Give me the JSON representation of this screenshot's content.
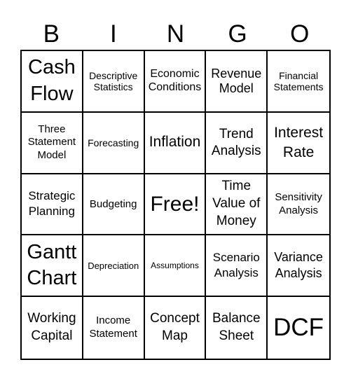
{
  "header": {
    "letters": [
      "B",
      "I",
      "N",
      "G",
      "O"
    ]
  },
  "board": {
    "rows": [
      [
        {
          "lines": [
            "Cash",
            "Flow"
          ]
        },
        {
          "lines": [
            "Descriptive",
            "Statistics"
          ]
        },
        {
          "lines": [
            "Economic",
            "Conditions"
          ]
        },
        {
          "lines": [
            "Revenue",
            "Model"
          ]
        },
        {
          "lines": [
            "Financial",
            "Statements"
          ]
        }
      ],
      [
        {
          "lines": [
            "Three",
            "Statement",
            "Model"
          ]
        },
        {
          "lines": [
            "Forecasting"
          ]
        },
        {
          "lines": [
            "Inflation"
          ]
        },
        {
          "lines": [
            "Trend",
            "Analysis"
          ]
        },
        {
          "lines": [
            "Interest",
            "Rate"
          ]
        }
      ],
      [
        {
          "lines": [
            "Strategic",
            "Planning"
          ]
        },
        {
          "lines": [
            "Budgeting"
          ]
        },
        {
          "lines": [
            "Free!"
          ]
        },
        {
          "lines": [
            "Time",
            "Value of",
            "Money"
          ]
        },
        {
          "lines": [
            "Sensitivity",
            "Analysis"
          ]
        }
      ],
      [
        {
          "lines": [
            "Gantt",
            "Chart"
          ]
        },
        {
          "lines": [
            "Depreciation"
          ]
        },
        {
          "lines": [
            "Assumptions"
          ]
        },
        {
          "lines": [
            "Scenario",
            "Analysis"
          ]
        },
        {
          "lines": [
            "Variance",
            "Analysis"
          ]
        }
      ],
      [
        {
          "lines": [
            "Working",
            "Capital"
          ]
        },
        {
          "lines": [
            "Income",
            "Statement"
          ]
        },
        {
          "lines": [
            "Concept",
            "Map"
          ]
        },
        {
          "lines": [
            "Balance",
            "Sheet"
          ]
        },
        {
          "lines": [
            "DCF"
          ]
        }
      ]
    ]
  },
  "colors": {
    "grid_line": "#000000",
    "text": "#000000",
    "background": "#ffffff"
  }
}
